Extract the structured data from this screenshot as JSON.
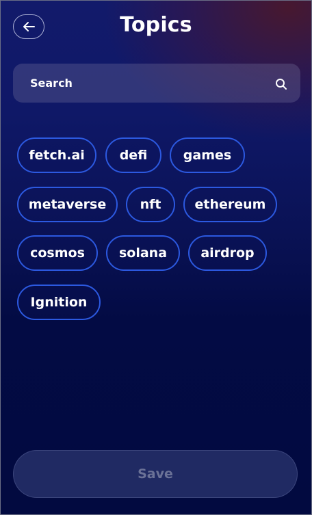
{
  "header": {
    "title": "Topics",
    "back_icon": "arrow-left-icon"
  },
  "search": {
    "placeholder": "Search",
    "icon": "search-icon"
  },
  "topics": [
    "fetch.ai",
    "defi",
    "games",
    "metaverse",
    "nft",
    "ethereum",
    "cosmos",
    "solana",
    "airdrop",
    "Ignition"
  ],
  "footer": {
    "save_label": "Save"
  },
  "colors": {
    "chip_border": "#2c59e0",
    "background_top": "#121a6b",
    "background_bottom": "#020a40",
    "save_text": "#6b7297"
  }
}
